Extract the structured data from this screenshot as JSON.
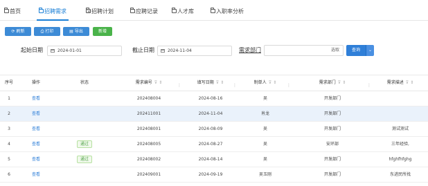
{
  "tabs": [
    {
      "label": "首页",
      "active": false
    },
    {
      "label": "招聘需求",
      "active": true
    },
    {
      "label": "招聘计划",
      "active": false
    },
    {
      "label": "应聘记录",
      "active": false
    },
    {
      "label": "人才库",
      "active": false
    },
    {
      "label": "入职率分析",
      "active": false
    }
  ],
  "tab_close_glyph": "×",
  "toolbar": {
    "refresh": "刷新",
    "print": "打印",
    "export": "导出",
    "add": "新增"
  },
  "filters": {
    "start_label": "起始日期",
    "start_value": "2024-01-01",
    "end_label": "截止日期",
    "end_value": "2024-11-04",
    "dept_label": "需求部门",
    "dept_value": "",
    "select_label": "选取",
    "query_label": "查询",
    "query_caret": "⌄"
  },
  "table": {
    "columns": [
      "序号",
      "操作",
      "状态",
      "需求编号",
      "填写日期",
      "制单人",
      "需求部门",
      "需求描述"
    ],
    "rows": [
      {
        "no": "1",
        "action": "查看",
        "status": "",
        "code": "202408004",
        "date": "2024-08-16",
        "maker": "吴",
        "dept": "开发部门",
        "desc": "",
        "selected": false
      },
      {
        "no": "2",
        "action": "查看",
        "status": "",
        "code": "202411001",
        "date": "2024-11-04",
        "maker": "肖龙",
        "dept": "开发部门",
        "desc": "",
        "selected": true
      },
      {
        "no": "3",
        "action": "查看",
        "status": "",
        "code": "202408001",
        "date": "2024-08-09",
        "maker": "吴",
        "dept": "开发部门",
        "desc": "测试测试",
        "selected": false
      },
      {
        "no": "4",
        "action": "查看",
        "status": "通过",
        "code": "202408005",
        "date": "2024-08-27",
        "maker": "吴",
        "dept": "安环部",
        "desc": "三年经验,",
        "selected": false
      },
      {
        "no": "5",
        "action": "查看",
        "status": "通过",
        "code": "202408002",
        "date": "2024-08-14",
        "maker": "吴",
        "dept": "开发部门",
        "desc": "hfghfhfghg",
        "selected": false
      },
      {
        "no": "6",
        "action": "查看",
        "status": "",
        "code": "202409001",
        "date": "2024-09-19",
        "maker": "吴玉刚",
        "dept": "开发部门",
        "desc": "东进民所找",
        "selected": false
      }
    ]
  },
  "colors": {
    "accent": "#1a7fd6",
    "primary_button": "#3d8bd6",
    "add_button": "#4ab34a",
    "selected_row": "#eaf2fb",
    "status_pass": "#52a34a"
  }
}
